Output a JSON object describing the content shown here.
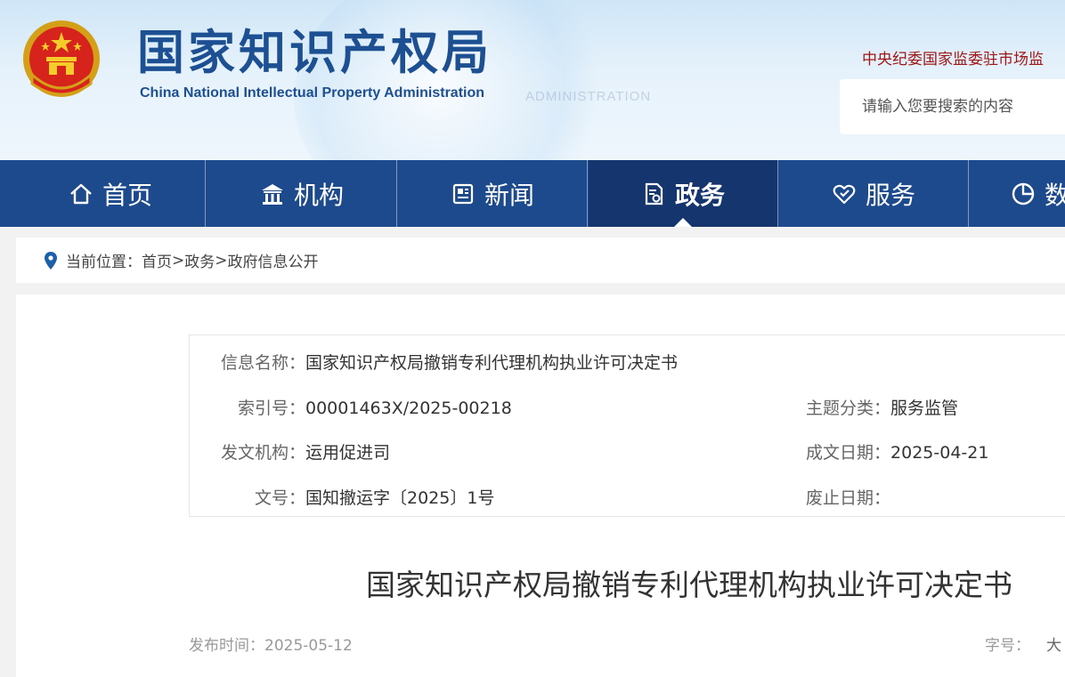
{
  "header": {
    "site_title": "国家知识产权局",
    "site_subtitle": "China National Intellectual Property Administration",
    "watermark": "ADMINISTRATION",
    "top_link": "中央纪委国家监委驻市场监",
    "search_placeholder": "请输入您要搜索的内容"
  },
  "nav": {
    "items": [
      {
        "label": "首页",
        "icon": "home-icon"
      },
      {
        "label": "机构",
        "icon": "institution-icon"
      },
      {
        "label": "新闻",
        "icon": "news-icon"
      },
      {
        "label": "政务",
        "icon": "government-affairs-icon",
        "active": true
      },
      {
        "label": "服务",
        "icon": "service-icon"
      },
      {
        "label": "数",
        "icon": "data-icon"
      }
    ]
  },
  "breadcrumb": {
    "prefix": "当前位置：",
    "items": [
      "首页",
      "政务",
      "政府信息公开"
    ],
    "separator": ">"
  },
  "meta": {
    "info_name_label": "信息名称：",
    "info_name": "国家知识产权局撤销专利代理机构执业许可决定书",
    "index_label": "索引号：",
    "index": "00001463X/2025-00218",
    "topic_label": "主题分类：",
    "topic": "服务监管",
    "issuer_label": "发文机构：",
    "issuer": "运用促进司",
    "date_label": "成文日期：",
    "date": "2025-04-21",
    "docno_label": "文号：",
    "docno": "国知撤运字〔2025〕1号",
    "expire_label": "废止日期：",
    "expire": ""
  },
  "article": {
    "title": "国家知识产权局撤销专利代理机构执业许可决定书",
    "publish_label": "发布时间：",
    "publish_date": "2025-05-12",
    "fontsize_label": "字号：",
    "fontsize_large": "大"
  },
  "colors": {
    "nav_bg": "#1d4a8c",
    "nav_active_bg": "#15356f",
    "nav_active_top": "#c94a4a",
    "title_blue": "#1d4f93",
    "top_link_red": "#a01616"
  }
}
